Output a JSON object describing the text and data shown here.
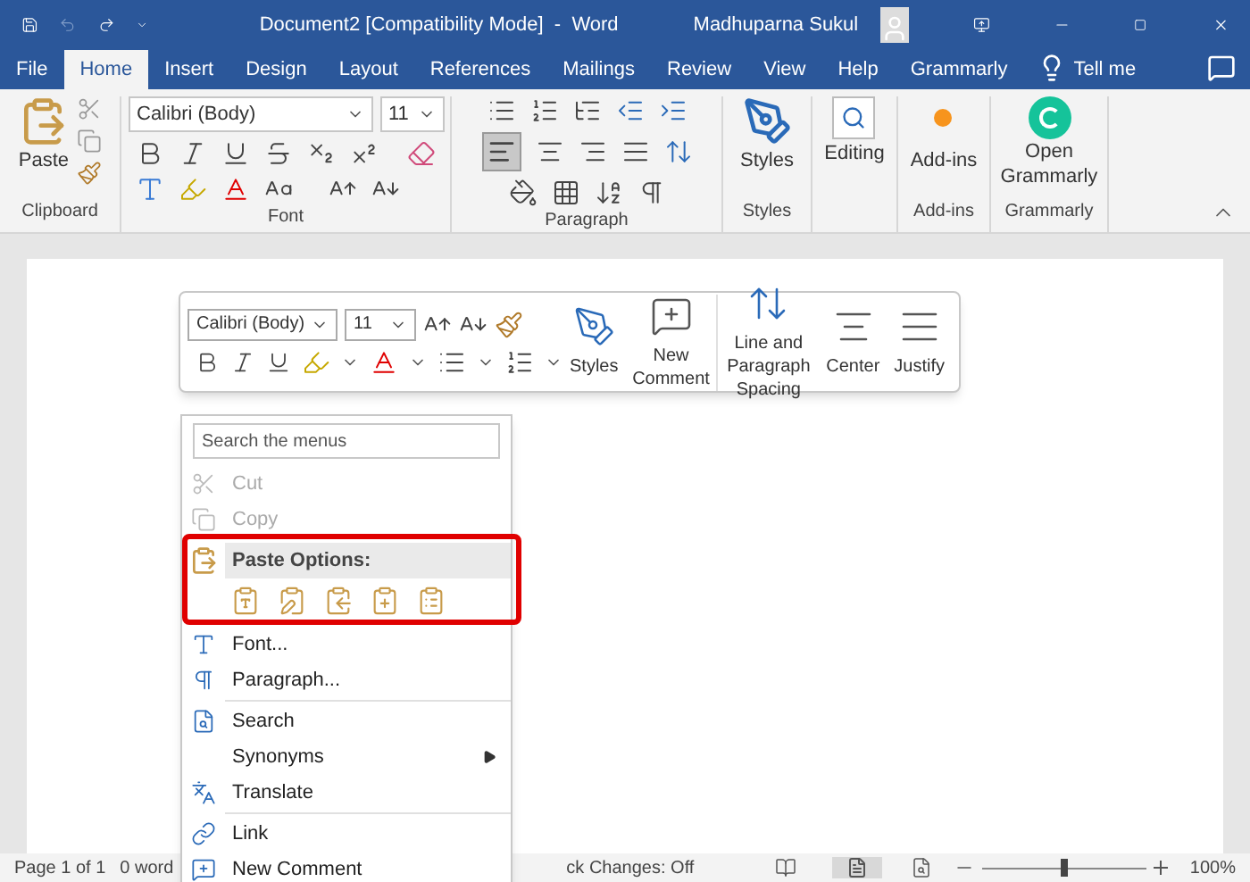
{
  "title_bar": {
    "title": "Document2 [Compatibility Mode]  -  Word",
    "user": "Madhuparna Sukul"
  },
  "tabs": [
    {
      "label": "File",
      "selected": false
    },
    {
      "label": "Home",
      "selected": true
    },
    {
      "label": "Insert",
      "selected": false
    },
    {
      "label": "Design",
      "selected": false
    },
    {
      "label": "Layout",
      "selected": false
    },
    {
      "label": "References",
      "selected": false
    },
    {
      "label": "Mailings",
      "selected": false
    },
    {
      "label": "Review",
      "selected": false
    },
    {
      "label": "View",
      "selected": false
    },
    {
      "label": "Help",
      "selected": false
    },
    {
      "label": "Grammarly",
      "selected": false
    }
  ],
  "tell_me": "Tell me",
  "ribbon": {
    "paste": "Paste",
    "clipboard_label": "Clipboard",
    "font_name": "Calibri (Body)",
    "font_size": "11",
    "font_label": "Font",
    "paragraph_label": "Paragraph",
    "styles": "Styles",
    "styles_label": "Styles",
    "editing": "Editing",
    "addins": "Add-ins",
    "addins_label": "Add-ins",
    "grammarly": "Open Grammarly",
    "grammarly_label": "Grammarly"
  },
  "mini_toolbar": {
    "font_name": "Calibri (Body)",
    "font_size": "11",
    "styles": "Styles",
    "new_comment": "New Comment",
    "spacing": "Line and Paragraph Spacing",
    "center": "Center",
    "justify": "Justify"
  },
  "context_menu": {
    "search": {
      "placeholder": "Search the menus"
    },
    "items": [
      {
        "kind": "item",
        "label": "Cut",
        "disabled": true
      },
      {
        "kind": "item",
        "label": "Copy",
        "disabled": true
      },
      {
        "kind": "paste",
        "label": "Paste Options:"
      },
      {
        "kind": "item",
        "label": "Font...",
        "disabled": false
      },
      {
        "kind": "item",
        "label": "Paragraph...",
        "disabled": false
      },
      {
        "kind": "divider"
      },
      {
        "kind": "item",
        "label": "Search",
        "disabled": false
      },
      {
        "kind": "submenu",
        "label": "Synonyms",
        "disabled": false
      },
      {
        "kind": "item",
        "label": "Translate",
        "disabled": false
      },
      {
        "kind": "divider"
      },
      {
        "kind": "item",
        "label": "Link",
        "disabled": false
      },
      {
        "kind": "item",
        "label": "New Comment",
        "disabled": false
      }
    ]
  },
  "status_bar": {
    "page": "Page 1 of 1",
    "words": "0 word",
    "track_changes": "ck Changes: Off",
    "zoom": {
      "level": 0.5,
      "reading": "100%"
    }
  }
}
